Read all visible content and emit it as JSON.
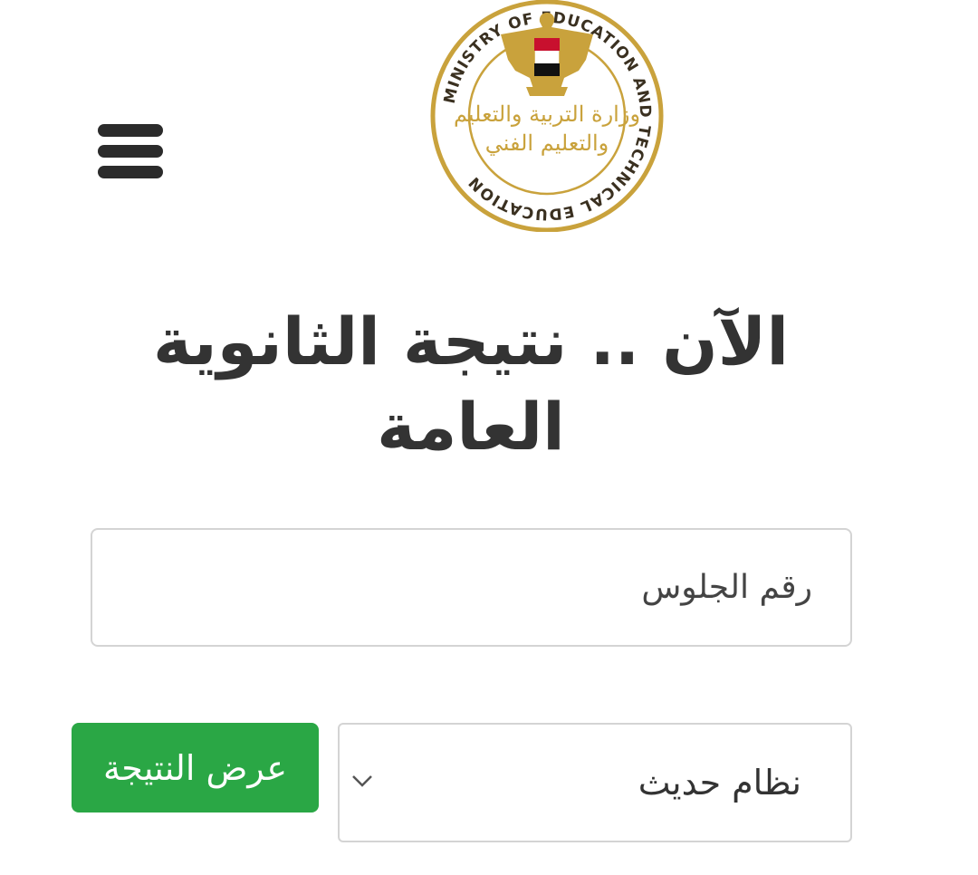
{
  "header": {
    "menu_icon": "hamburger-menu-icon",
    "logo": {
      "ring_text": "MINISTRY OF EDUCATION AND TECHNICAL EDUCATION",
      "arabic_line1": "وزارة التربية والتعليم",
      "arabic_line2": "والتعليم الفني",
      "colors": {
        "gold": "#c9a23c",
        "flag_red": "#c8102e",
        "flag_black": "#111111"
      }
    }
  },
  "main": {
    "headline": "الآن .. نتيجة الثانوية العامة",
    "seat_number": {
      "value": "",
      "placeholder": "رقم الجلوس"
    },
    "system_select": {
      "selected": "نظام حديث",
      "icon": "chevron-down-icon"
    },
    "submit_label": "عرض النتيجة"
  },
  "colors": {
    "button_green": "#2aa745",
    "heading_text": "#333333",
    "border": "#d4d4d4"
  }
}
